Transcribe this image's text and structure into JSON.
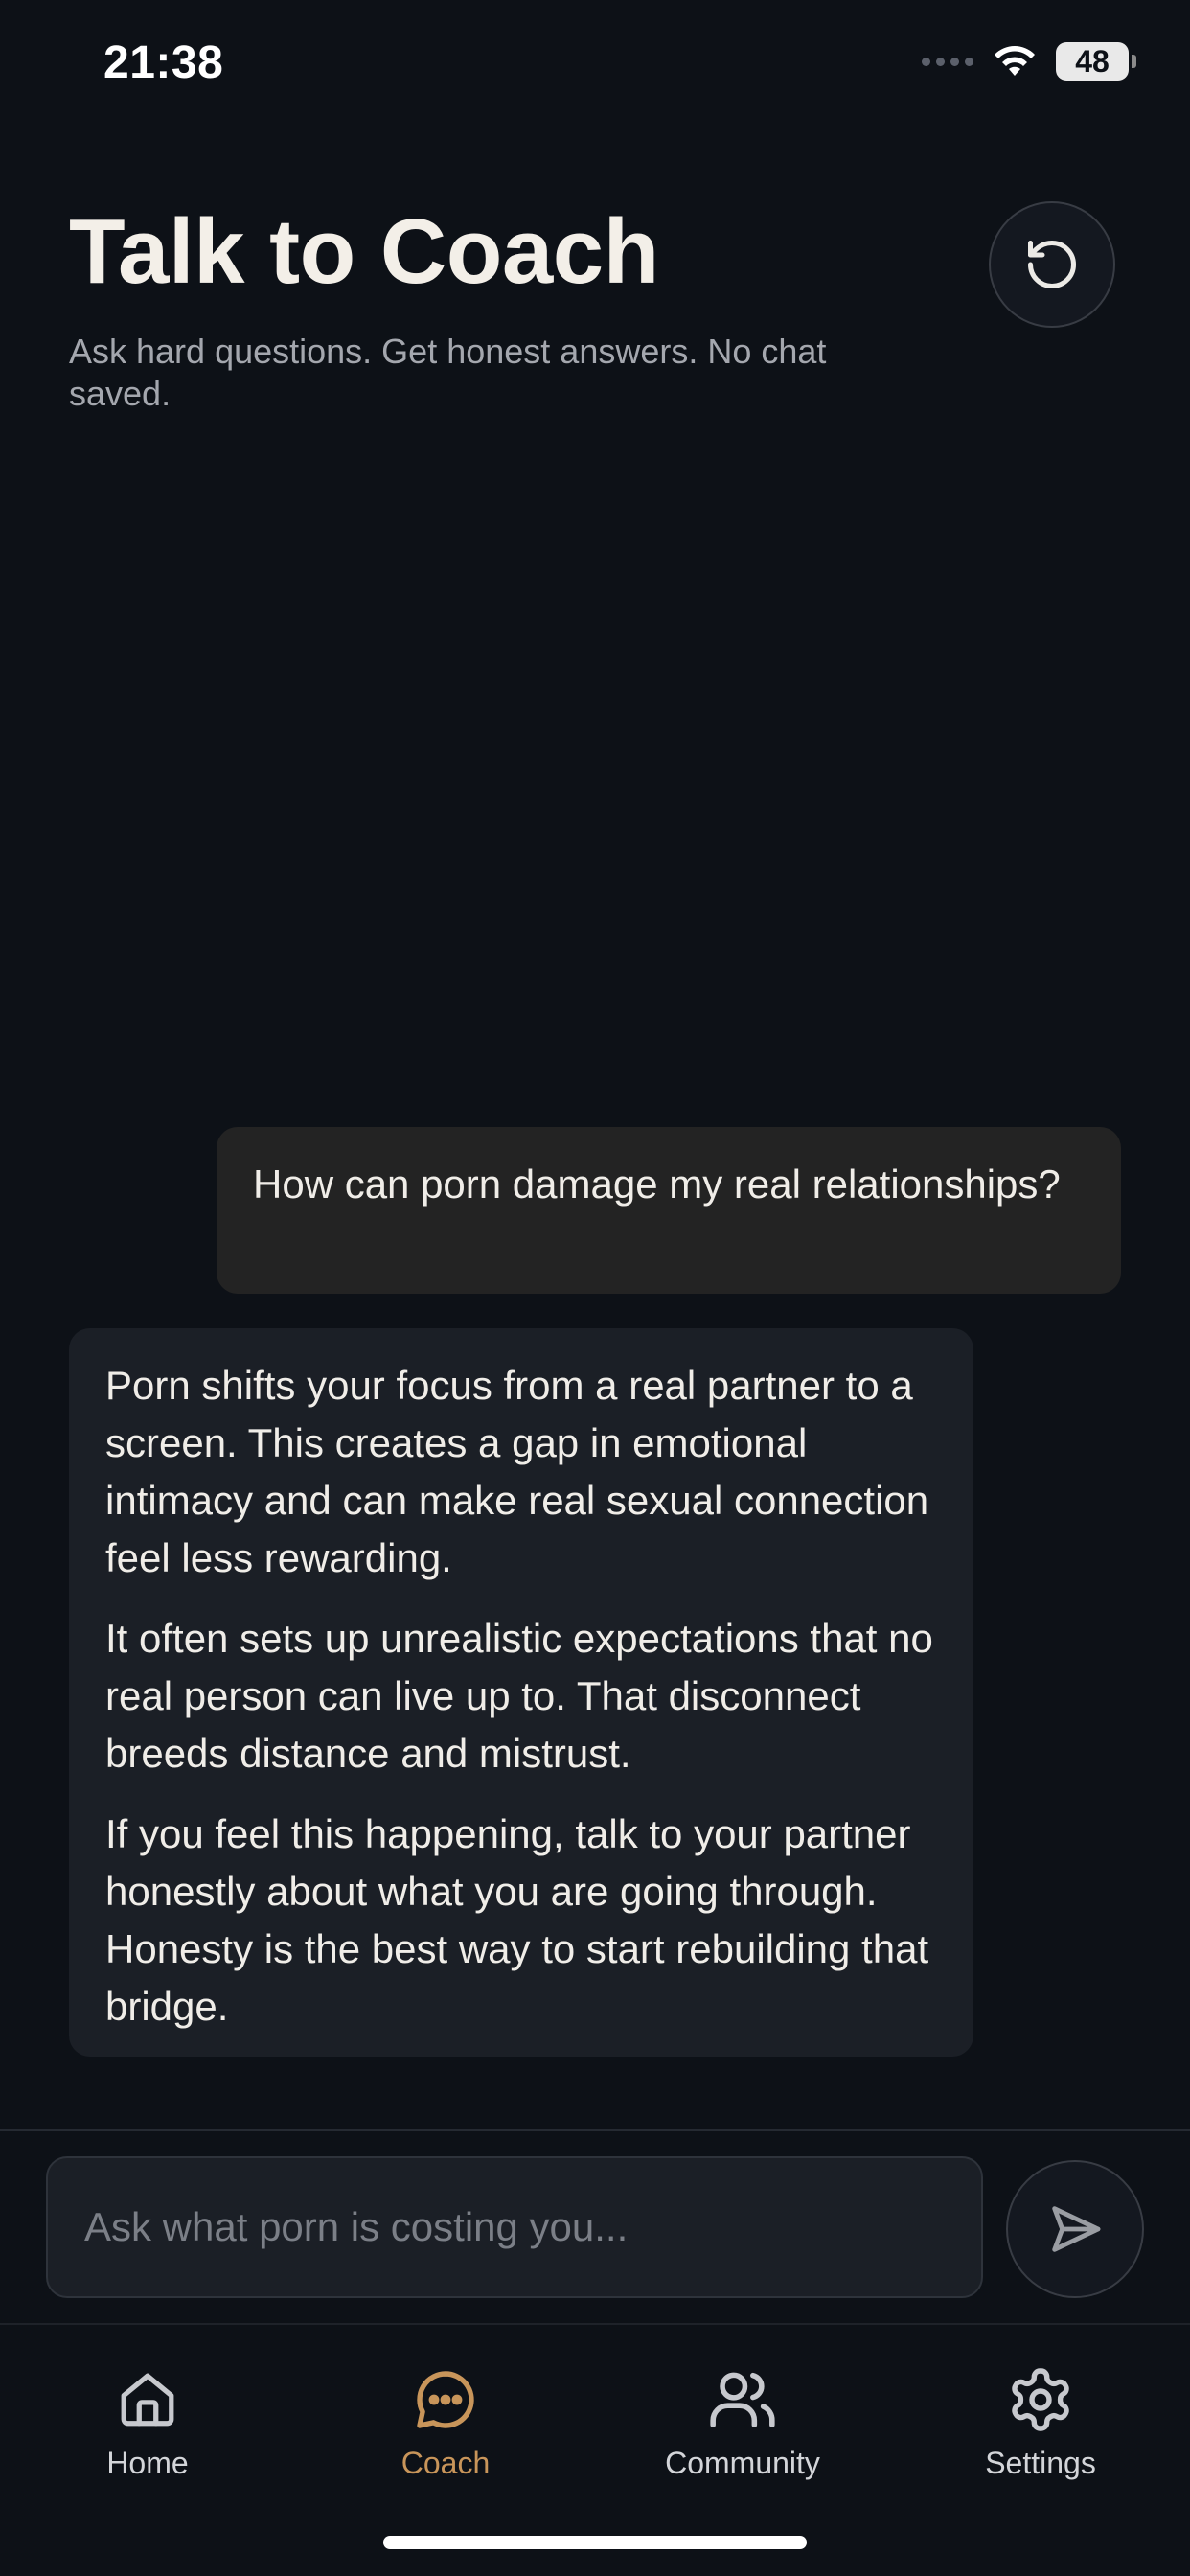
{
  "status_bar": {
    "time": "21:38",
    "battery": "48",
    "icons": [
      "signal-dots-icon",
      "wifi-icon",
      "battery-icon"
    ]
  },
  "header": {
    "title": "Talk to Coach",
    "subtitle": "Ask hard questions. Get honest answers. No chat saved.",
    "reset_icon": "refresh-icon"
  },
  "messages": [
    {
      "role": "user",
      "text": "How can porn damage my real relationships?"
    },
    {
      "role": "coach",
      "paragraphs": [
        "Porn shifts your focus from a real partner to a screen. This creates a gap in emotional intimacy and can make real sexual connection feel less rewarding.",
        "It often sets up unrealistic expectations that no real person can live up to. That disconnect breeds distance and mistrust.",
        "If you feel this happening, talk to your partner honestly about what you are going through. Honesty is the best way to start rebuilding that bridge."
      ]
    }
  ],
  "composer": {
    "placeholder": "Ask what porn is costing you...",
    "value": "",
    "send_icon": "send-icon"
  },
  "tabs": [
    {
      "label": "Home",
      "icon": "home-icon",
      "active": false
    },
    {
      "label": "Coach",
      "icon": "chat-bubble-icon",
      "active": true
    },
    {
      "label": "Community",
      "icon": "users-icon",
      "active": false
    },
    {
      "label": "Settings",
      "icon": "gear-icon",
      "active": false
    }
  ],
  "colors": {
    "background": "#0d1117",
    "accent": "#c8955a",
    "user_bubble": "#232323",
    "coach_bubble": "#1b1f26",
    "muted_text": "#a4a7ae"
  }
}
